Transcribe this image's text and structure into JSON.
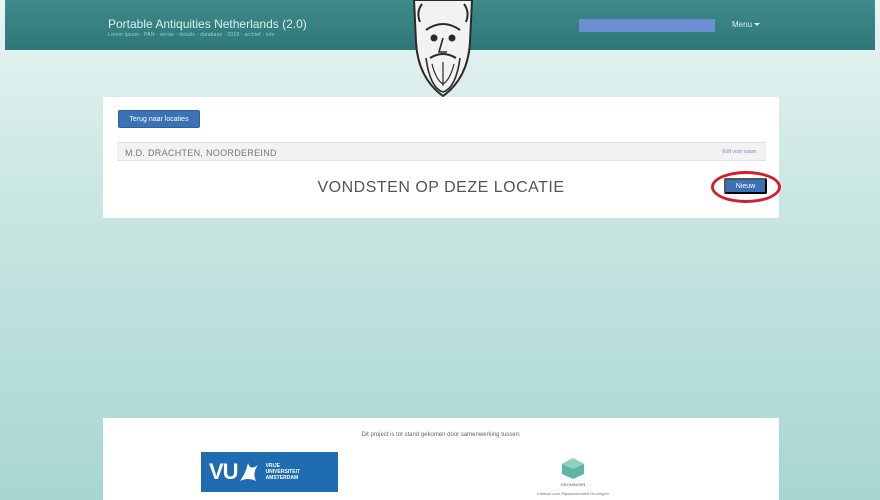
{
  "header": {
    "brand": "Portable Antiquities Netherlands (2.0)",
    "brand_sub": "Lorem ipsum · PAN · versie · details · database · 2018 · archief · info",
    "menu_label": "Menu",
    "colors": {
      "bar": "#2f7777",
      "search": "#6c8fd3"
    }
  },
  "card": {
    "back_button": "Terug naar locaties",
    "location_name": "M.D. DRACHTEN, NOORDEREIND",
    "location_link": "Edit voor naam",
    "section_title": "VONDSTEN OP DEZE LOCATIE",
    "new_button": "Nieuw"
  },
  "footer": {
    "text": "Dit project is tot stand gekomen door samenwerking tussen:",
    "vu_letters": "VU",
    "vu_line1": "VRIJE",
    "vu_line2": "UNIVERSITEIT",
    "vu_line3": "AMSTERDAM",
    "rug_line1": "GRONINGEN",
    "rug_line2": "Instituut voor Rijksuniversiteit Groningen"
  },
  "colors": {
    "primary_button": "#3a72b5",
    "highlight": "#d21f2a"
  }
}
